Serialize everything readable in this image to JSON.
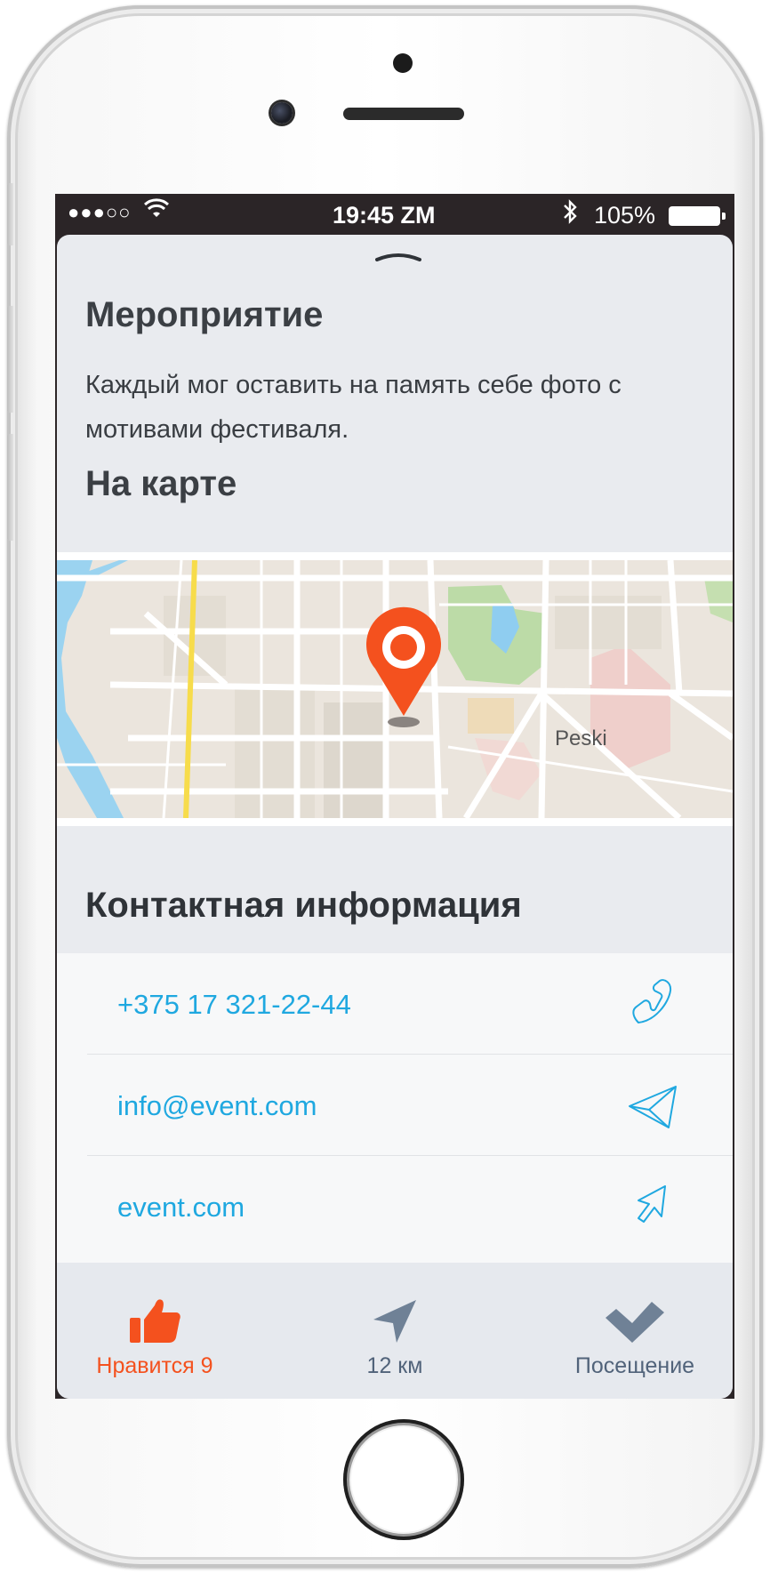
{
  "status_bar": {
    "signal": "●●●○○",
    "wifi_icon": "wifi-icon",
    "time": "19:45 ZM",
    "bluetooth_icon": "bluetooth-icon",
    "battery": "105%"
  },
  "event": {
    "title": "Мероприятие",
    "description": "Каждый мог оставить на память себе фото с мотивами фестиваля."
  },
  "map": {
    "title": "На карте",
    "place_label": "Peski",
    "pin_color": "#f4511e"
  },
  "contacts": {
    "title": "Контактная информация",
    "items": [
      {
        "value": "+375 17 321-22-44",
        "icon": "phone-icon"
      },
      {
        "value": "info@event.com",
        "icon": "send-icon"
      },
      {
        "value": "event.com",
        "icon": "cursor-icon"
      }
    ],
    "link_color": "#1fa8e0"
  },
  "tab_bar": {
    "items": [
      {
        "label": "Нравится 9",
        "icon": "thumbs-up-icon",
        "active": true
      },
      {
        "label": "12 км",
        "icon": "navigation-arrow-icon",
        "active": false
      },
      {
        "label": "Посещение",
        "icon": "check-mark-icon",
        "active": false
      }
    ],
    "active_color": "#f4511e",
    "inactive_color": "#6f8196"
  }
}
